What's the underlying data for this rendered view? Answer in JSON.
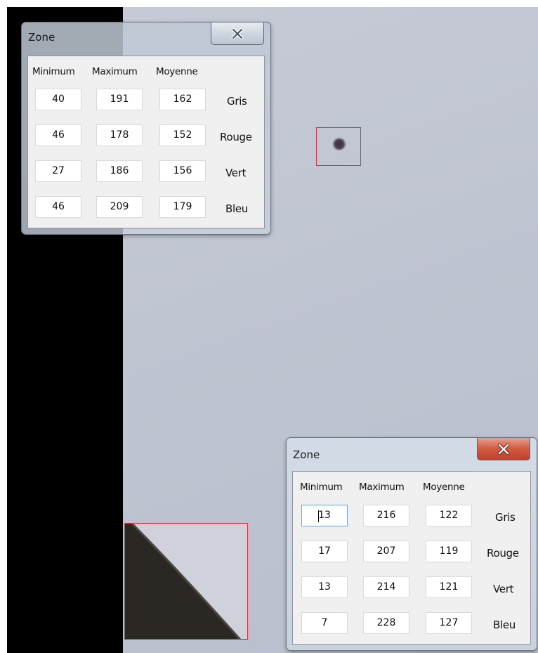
{
  "colors": {
    "selection_border": "#e0303a",
    "close_active": "#c2402a",
    "close_inactive": "#cfd6df"
  },
  "windows": [
    {
      "title": "Zone",
      "close_icon": "close-icon",
      "headers": [
        "Minimum",
        "Maximum",
        "Moyenne"
      ],
      "rows": [
        {
          "label": "Gris",
          "min": "40",
          "max": "191",
          "avg": "162"
        },
        {
          "label": "Rouge",
          "min": "46",
          "max": "178",
          "avg": "152"
        },
        {
          "label": "Vert",
          "min": "27",
          "max": "186",
          "avg": "156"
        },
        {
          "label": "Bleu",
          "min": "46",
          "max": "209",
          "avg": "179"
        }
      ]
    },
    {
      "title": "Zone",
      "close_icon": "close-icon",
      "headers": [
        "Minimum",
        "Maximum",
        "Moyenne"
      ],
      "rows": [
        {
          "label": "Gris",
          "min": "13",
          "max": "216",
          "avg": "122"
        },
        {
          "label": "Rouge",
          "min": "17",
          "max": "207",
          "avg": "119"
        },
        {
          "label": "Vert",
          "min": "13",
          "max": "214",
          "avg": "121"
        },
        {
          "label": "Bleu",
          "min": "7",
          "max": "228",
          "avg": "127"
        }
      ]
    }
  ]
}
